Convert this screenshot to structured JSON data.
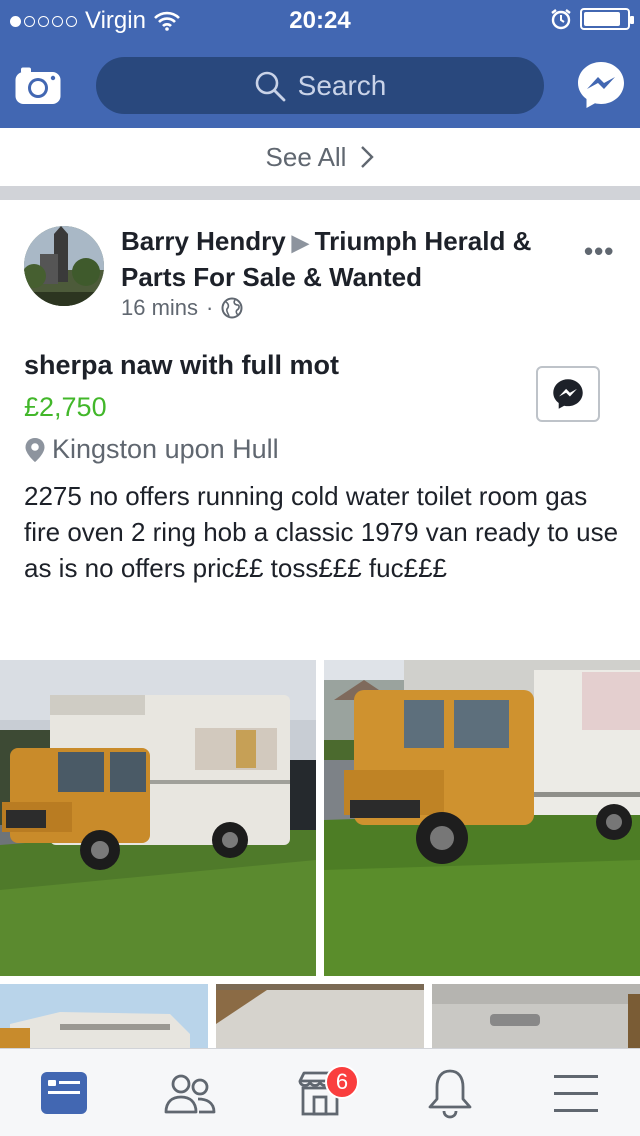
{
  "status_bar": {
    "carrier": "Virgin",
    "time": "20:24",
    "signal_bars_filled": 1,
    "signal_bars_total": 5,
    "battery_level": 0.85
  },
  "header": {
    "search_placeholder": "Search",
    "brand_color": "#4267b2"
  },
  "see_all": {
    "label": "See All"
  },
  "post": {
    "author": "Barry Hendry",
    "group": "Triumph Herald & Parts For Sale & Wanted",
    "time": "16 mins",
    "title": "sherpa naw with full mot",
    "price": "£2,750",
    "location": "Kingston upon Hull",
    "description": "2275 no offers running cold water toilet room gas fire oven 2 ring hob a classic 1979 van ready to use as is no offers pric££ toss£££ fuc£££"
  },
  "tabbar": {
    "items": [
      {
        "icon": "news-feed-icon",
        "active": true
      },
      {
        "icon": "friends-icon",
        "active": false
      },
      {
        "icon": "marketplace-icon",
        "active": false,
        "badge": "6"
      },
      {
        "icon": "notifications-icon",
        "active": false
      },
      {
        "icon": "menu-icon",
        "active": false
      }
    ],
    "active_color": "#4267b2",
    "badge_color": "#fa3e3e"
  }
}
